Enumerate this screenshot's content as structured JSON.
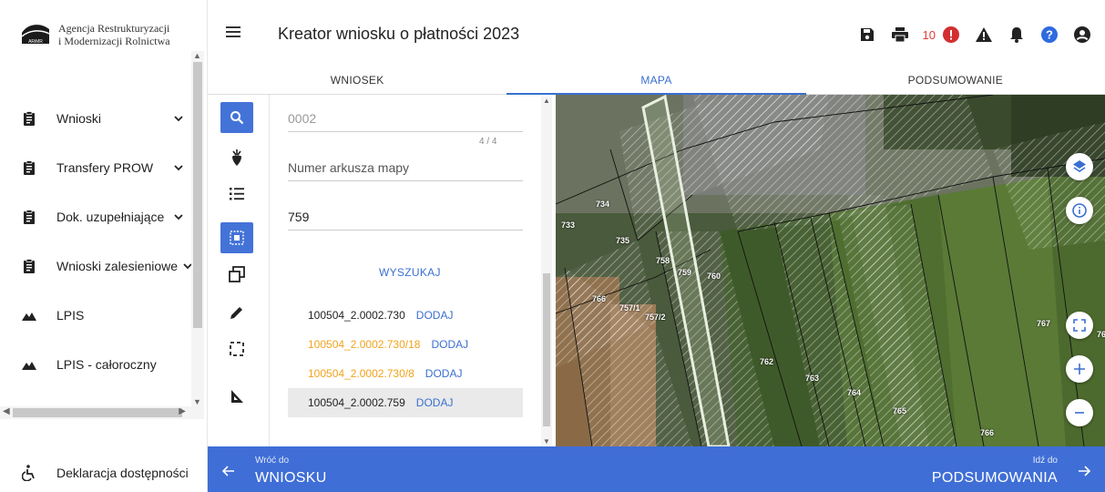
{
  "logo": {
    "line1": "Agencja Restrukturyzacji",
    "line2": "i Modernizacji Rolnictwa",
    "mark_label": "ARiMR"
  },
  "sidebar": {
    "items": [
      {
        "label": "Wnioski",
        "icon": "clipboard-icon",
        "expandable": true
      },
      {
        "label": "Transfery PROW",
        "icon": "clipboard-icon",
        "expandable": true
      },
      {
        "label": "Dok. uzupełniające",
        "icon": "clipboard-icon",
        "expandable": true
      },
      {
        "label": "Wnioski zalesieniowe",
        "icon": "clipboard-icon",
        "expandable": true
      },
      {
        "label": "LPIS",
        "icon": "mountain-icon",
        "expandable": false
      },
      {
        "label": "LPIS - całoroczny",
        "icon": "mountain-icon",
        "expandable": false
      }
    ],
    "accessibility": {
      "label": "Deklaracja dostępności",
      "icon": "accessibility-icon"
    }
  },
  "header": {
    "title": "Kreator wniosku o płatności 2023",
    "notification_count": "10",
    "icons": [
      "save-icon",
      "print-icon",
      "error-icon",
      "warning-icon",
      "bell-icon",
      "help-icon",
      "user-icon"
    ]
  },
  "tabs": [
    {
      "label": "WNIOSEK",
      "active": false
    },
    {
      "label": "MAPA",
      "active": true
    },
    {
      "label": "PODSUMOWANIE",
      "active": false
    }
  ],
  "tools": [
    {
      "icon": "search-icon",
      "active": true
    },
    {
      "icon": "sugar-beet-icon",
      "active": false
    },
    {
      "icon": "list-icon",
      "active": false
    },
    {
      "icon": "select-area-icon",
      "active": true
    },
    {
      "icon": "copy-shape-icon",
      "active": false
    },
    {
      "icon": "pencil-icon",
      "active": false
    },
    {
      "icon": "dashed-rectangle-icon",
      "active": false
    },
    {
      "icon": "measure-angle-icon",
      "active": false
    }
  ],
  "search": {
    "sheet_value": "0002",
    "counter": "4 / 4",
    "map_sheet_placeholder": "Numer arkusza mapy",
    "plot_number_value": "759",
    "search_button": "WYSZUKAJ",
    "results": [
      {
        "id": "100504_2.0002.730",
        "action": "DODAJ",
        "warning": false,
        "selected": false
      },
      {
        "id": "100504_2.0002.730/18",
        "action": "DODAJ",
        "warning": true,
        "selected": false
      },
      {
        "id": "100504_2.0002.730/8",
        "action": "DODAJ",
        "warning": true,
        "selected": false
      },
      {
        "id": "100504_2.0002.759",
        "action": "DODAJ",
        "warning": false,
        "selected": true
      }
    ]
  },
  "map": {
    "plot_labels": [
      "733",
      "734",
      "735",
      "758",
      "759",
      "760",
      "766",
      "757/1",
      "757/2",
      "762",
      "763",
      "764",
      "765",
      "766",
      "767",
      "76"
    ],
    "controls": [
      "layers-icon",
      "info-icon",
      "fullscreen-icon",
      "zoom-in-icon",
      "zoom-out-icon"
    ]
  },
  "footer": {
    "back_small": "Wróć do",
    "back_big": "WNIOSKU",
    "next_small": "Idź do",
    "next_big": "PODSUMOWANIA"
  },
  "colors": {
    "accent": "#3f6ed6",
    "warning_text": "#f2a21b",
    "error": "#e53935"
  }
}
